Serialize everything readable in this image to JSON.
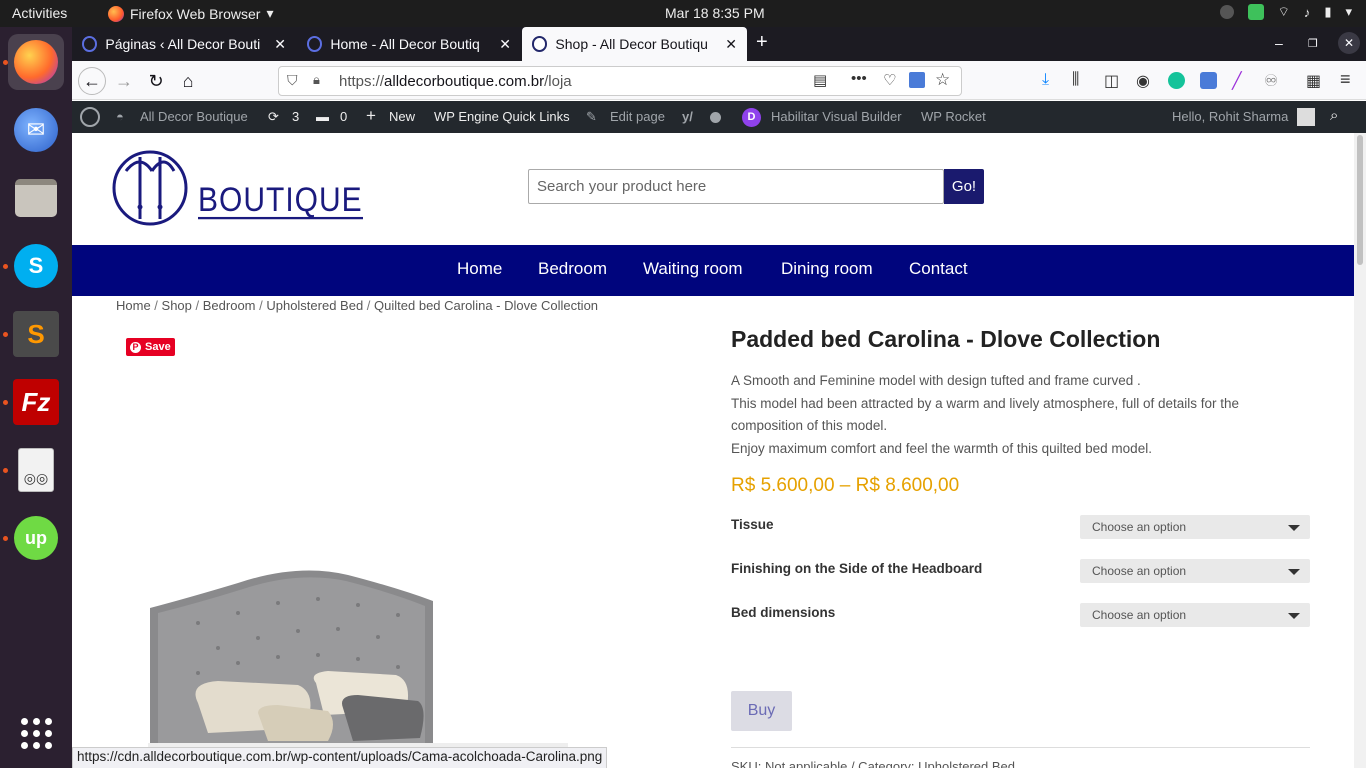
{
  "topbar": {
    "activities": "Activities",
    "app_name": "Firefox Web Browser",
    "clock": "Mar 18  8:35 PM"
  },
  "dock": {
    "items": [
      "firefox",
      "thunderbird",
      "files",
      "skype",
      "sublime-text",
      "filezilla",
      "document-viewer",
      "upwork"
    ],
    "apps_grid": "show-applications"
  },
  "browser": {
    "tabs": [
      {
        "title": "Páginas ‹ All Decor Bouti"
      },
      {
        "title": "Home - All Decor Boutiq"
      },
      {
        "title": "Shop - All Decor Boutiqu"
      }
    ],
    "url_prefix": "https://",
    "url_domain": "alldecorboutique.com.br",
    "url_path": "/loja",
    "status_url": "https://cdn.alldecorboutique.com.br/wp-content/uploads/Cama-acolchoada-Carolina.png"
  },
  "wp_admin": {
    "site_name": "All Decor Boutique",
    "updates_count": "3",
    "comments_count": "0",
    "new_label": "New",
    "engine_links": "WP Engine Quick Links",
    "edit_page": "Edit page",
    "visual_builder": "Habilitar Visual Builder",
    "wp_rocket": "WP Rocket",
    "greeting": "Hello, Rohit Sharma"
  },
  "site": {
    "logo_text": "BOUTIQUE",
    "search_placeholder": "Search your product here",
    "search_button": "Go!",
    "nav": [
      "Home",
      "Bedroom",
      "Waiting room",
      "Dining room",
      "Contact"
    ],
    "breadcrumb": [
      "Home",
      "Shop",
      "Bedroom",
      "Upholstered Bed",
      "Quilted bed Carolina - Dlove Collection"
    ],
    "pin_label": "Save"
  },
  "product": {
    "title": "Padded bed Carolina - Dlove Collection",
    "description": [
      "A Smooth and Feminine model with design tufted and frame curved .",
      "This model had been attracted by a warm and lively atmosphere, full of details for the composition of this model.",
      "Enjoy maximum comfort and feel the warmth of this quilted bed model."
    ],
    "price": "R$  5.600,00 – R$  8.600,00",
    "variations": [
      {
        "label": "Tissue",
        "value": "Choose an option"
      },
      {
        "label": "Finishing on the Side of the Headboard",
        "value": "Choose an option"
      },
      {
        "label": "Bed dimensions",
        "value": "Choose an option"
      }
    ],
    "buy_button": "Buy",
    "sku_text": "SKU: Not applicable / Category: ",
    "sku_category": "Upholstered Bed"
  },
  "colors": {
    "nav_bg": "#00057d",
    "price": "#e6a100",
    "logo": "#1a1a7e",
    "pinterest": "#e60023"
  }
}
